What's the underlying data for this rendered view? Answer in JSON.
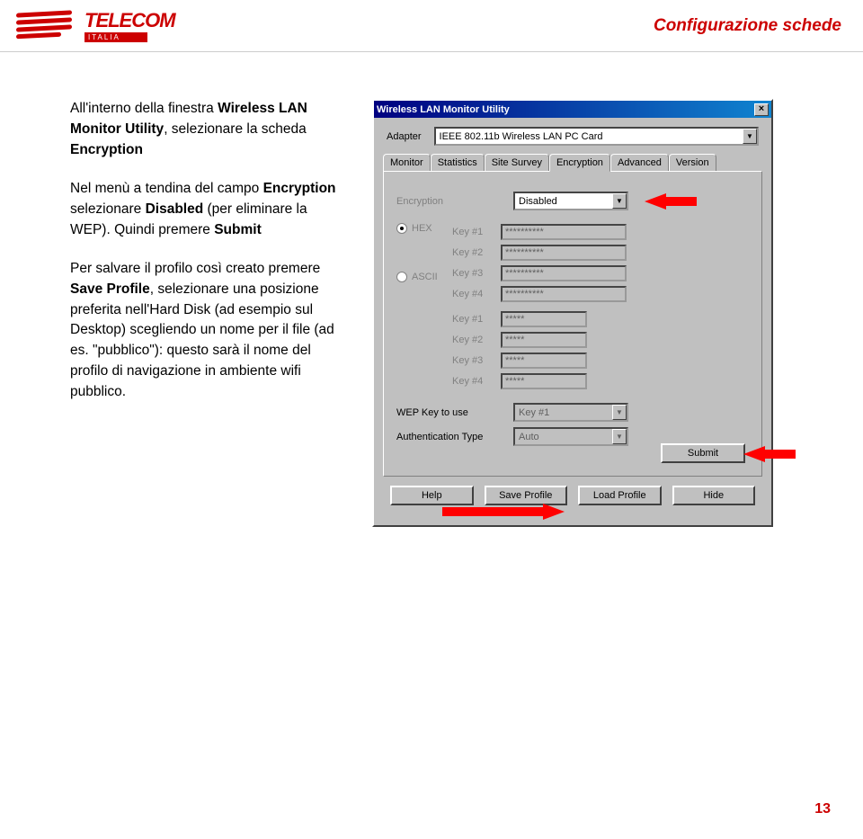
{
  "header": {
    "logo_brand": "TELECOM",
    "logo_sub": "ITALIA",
    "title": "Configurazione schede"
  },
  "body": {
    "p1_a": "All'interno della finestra ",
    "p1_b": "Wireless LAN Monitor Utility",
    "p1_c": ", selezionare la scheda ",
    "p1_d": "Encryption",
    "p2_a": "Nel menù a tendina del campo ",
    "p2_b": "Encryption",
    "p2_c": " selezionare ",
    "p2_d": "Disabled",
    "p2_e": " (per eliminare la WEP). Quindi premere ",
    "p2_f": "Submit",
    "p3_a": "Per salvare il profilo così creato premere ",
    "p3_b": "Save Profile",
    "p3_c": ", selezionare una posizione preferita nell'Hard Disk (ad esempio sul Desktop) scegliendo un nome per il file (ad es. \"pubblico\"): questo sarà il nome del profilo di navigazione in ambiente wifi pubblico."
  },
  "dialog": {
    "title": "Wireless LAN Monitor Utility",
    "adapter_label": "Adapter",
    "adapter_value": "IEEE 802.11b Wireless LAN PC Card",
    "tabs": [
      "Monitor",
      "Statistics",
      "Site Survey",
      "Encryption",
      "Advanced",
      "Version"
    ],
    "enc_label": "Encryption",
    "enc_value": "Disabled",
    "radio_hex": "HEX",
    "radio_ascii": "ASCII",
    "keys_hex": [
      "Key #1",
      "Key #2",
      "Key #3",
      "Key #4"
    ],
    "keys_ascii": [
      "Key #1",
      "Key #2",
      "Key #3",
      "Key #4"
    ],
    "key_mask_long": "**********",
    "key_mask_short": "*****",
    "wep_label": "WEP Key to use",
    "wep_value": "Key #1",
    "auth_label": "Authentication Type",
    "auth_value": "Auto",
    "submit": "Submit",
    "buttons": [
      "Help",
      "Save Profile",
      "Load Profile",
      "Hide"
    ]
  },
  "page_number": "13"
}
